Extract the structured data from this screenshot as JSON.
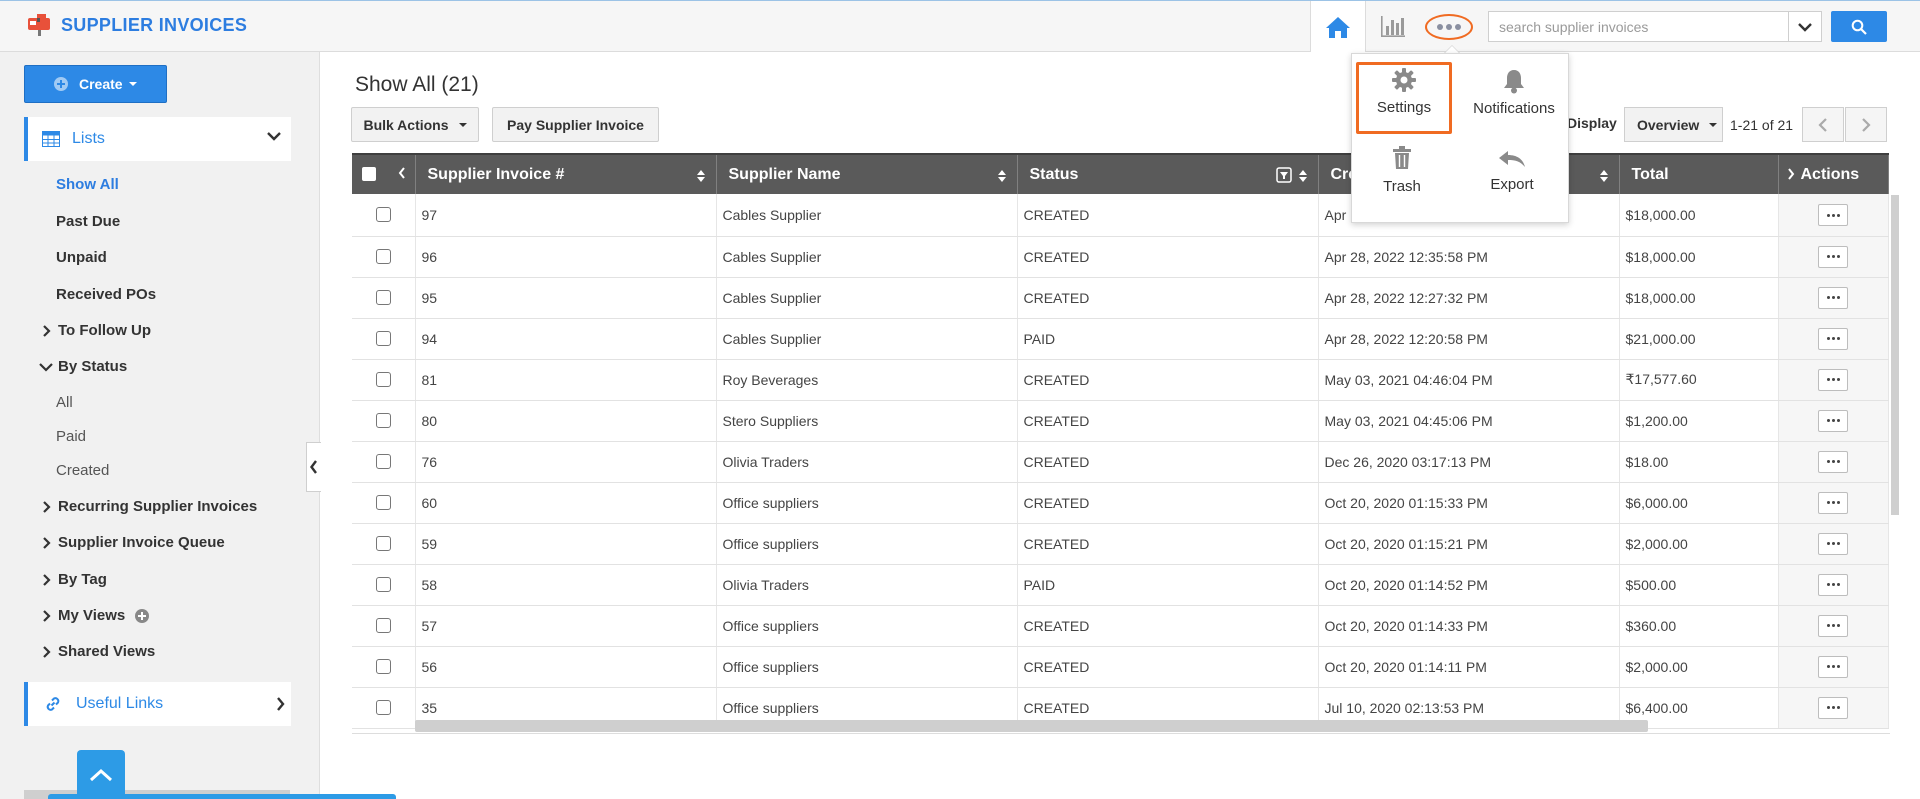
{
  "header": {
    "app_title": "SUPPLIER INVOICES",
    "search_placeholder": "search supplier invoices"
  },
  "more_menu": {
    "settings": "Settings",
    "notifications": "Notifications",
    "trash": "Trash",
    "export": "Export"
  },
  "sidebar": {
    "create_label": "Create",
    "lists_label": "Lists",
    "items": {
      "show_all": "Show All",
      "past_due": "Past Due",
      "unpaid": "Unpaid",
      "received_pos": "Received POs",
      "to_follow_up": "To Follow Up",
      "by_status": "By Status",
      "status_all": "All",
      "status_paid": "Paid",
      "status_created": "Created",
      "recurring": "Recurring Supplier Invoices",
      "queue": "Supplier Invoice Queue",
      "by_tag": "By Tag",
      "my_views": "My Views",
      "shared_views": "Shared Views"
    },
    "useful_links_label": "Useful Links"
  },
  "main": {
    "heading": "Show All (21)",
    "bulk_actions_label": "Bulk Actions",
    "pay_label": "Pay Supplier Invoice",
    "display_label": "Display",
    "display_value": "Overview",
    "page_count": "1-21 of 21"
  },
  "table": {
    "columns": {
      "invoice_no": "Supplier Invoice #",
      "supplier_name": "Supplier Name",
      "status": "Status",
      "created": "Cre",
      "total": "Total",
      "actions": "Actions"
    },
    "rows": [
      {
        "no": "97",
        "supplier": "Cables Supplier",
        "status": "CREATED",
        "created": "Apr",
        "total": "$18,000.00"
      },
      {
        "no": "96",
        "supplier": "Cables Supplier",
        "status": "CREATED",
        "created": "Apr 28, 2022 12:35:58 PM",
        "total": "$18,000.00"
      },
      {
        "no": "95",
        "supplier": "Cables Supplier",
        "status": "CREATED",
        "created": "Apr 28, 2022 12:27:32 PM",
        "total": "$18,000.00"
      },
      {
        "no": "94",
        "supplier": "Cables Supplier",
        "status": "PAID",
        "created": "Apr 28, 2022 12:20:58 PM",
        "total": "$21,000.00"
      },
      {
        "no": "81",
        "supplier": "Roy Beverages",
        "status": "CREATED",
        "created": "May 03, 2021 04:46:04 PM",
        "total": "₹17,577.60"
      },
      {
        "no": "80",
        "supplier": "Stero Suppliers",
        "status": "CREATED",
        "created": "May 03, 2021 04:45:06 PM",
        "total": "$1,200.00"
      },
      {
        "no": "76",
        "supplier": "Olivia Traders",
        "status": "CREATED",
        "created": "Dec 26, 2020 03:17:13 PM",
        "total": "$18.00"
      },
      {
        "no": "60",
        "supplier": "Office suppliers",
        "status": "CREATED",
        "created": "Oct 20, 2020 01:15:33 PM",
        "total": "$6,000.00"
      },
      {
        "no": "59",
        "supplier": "Office suppliers",
        "status": "CREATED",
        "created": "Oct 20, 2020 01:15:21 PM",
        "total": "$2,000.00"
      },
      {
        "no": "58",
        "supplier": "Olivia Traders",
        "status": "PAID",
        "created": "Oct 20, 2020 01:14:52 PM",
        "total": "$500.00"
      },
      {
        "no": "57",
        "supplier": "Office suppliers",
        "status": "CREATED",
        "created": "Oct 20, 2020 01:14:33 PM",
        "total": "$360.00"
      },
      {
        "no": "56",
        "supplier": "Office suppliers",
        "status": "CREATED",
        "created": "Oct 20, 2020 01:14:11 PM",
        "total": "$2,000.00"
      },
      {
        "no": "35",
        "supplier": "Office suppliers",
        "status": "CREATED",
        "created": "Jul 10, 2020 02:13:53 PM",
        "total": "$6,400.00"
      }
    ]
  },
  "colors": {
    "accent": "#2d89e6",
    "highlight": "#f06b22",
    "header_dark": "#5a5a5a"
  },
  "icons": [
    "app-logo-icon",
    "home-icon",
    "bar-chart-icon",
    "more-icon",
    "chevron-down-icon",
    "search-icon",
    "plus-icon",
    "table-icon",
    "gear-icon",
    "bell-icon",
    "trash-icon",
    "export-icon",
    "link-icon",
    "chevron-right-icon",
    "chevron-left-icon",
    "sort-icon",
    "filter-icon",
    "chevron-up-icon",
    "ellipsis-icon"
  ]
}
